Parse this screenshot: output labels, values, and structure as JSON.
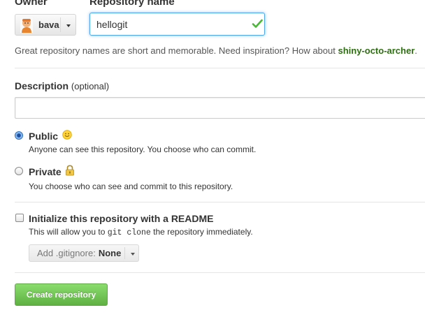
{
  "owner": {
    "label": "Owner",
    "selected": "bava",
    "avatar_icon": "user-avatar"
  },
  "repo_name": {
    "label": "Repository name",
    "value": "hellogit",
    "valid_icon": "check-icon"
  },
  "hint": {
    "text": "Great repository names are short and memorable. Need inspiration? How about ",
    "suggestion": "shiny-octo-archer",
    "end": "."
  },
  "description": {
    "label": "Description",
    "optional": "(optional)",
    "value": ""
  },
  "visibility": {
    "selected": "public",
    "public": {
      "title": "Public",
      "desc": "Anyone can see this repository. You choose who can commit.",
      "icon": "smiley-icon"
    },
    "private": {
      "title": "Private",
      "desc": "You choose who can see and commit to this repository.",
      "icon": "lock-icon"
    }
  },
  "init": {
    "checked": false,
    "title": "Initialize this repository with a README",
    "desc_before": "This will allow you to ",
    "desc_code": "git clone",
    "desc_after": " the repository immediately."
  },
  "gitignore": {
    "prefix": "Add .gitignore:",
    "value": "None"
  },
  "create_button": "Create repository",
  "colors": {
    "accent_blue": "#51a7e8",
    "suggestion_green": "#2d6e11",
    "create_green": "#60b044",
    "check_green": "#4bb63a"
  }
}
